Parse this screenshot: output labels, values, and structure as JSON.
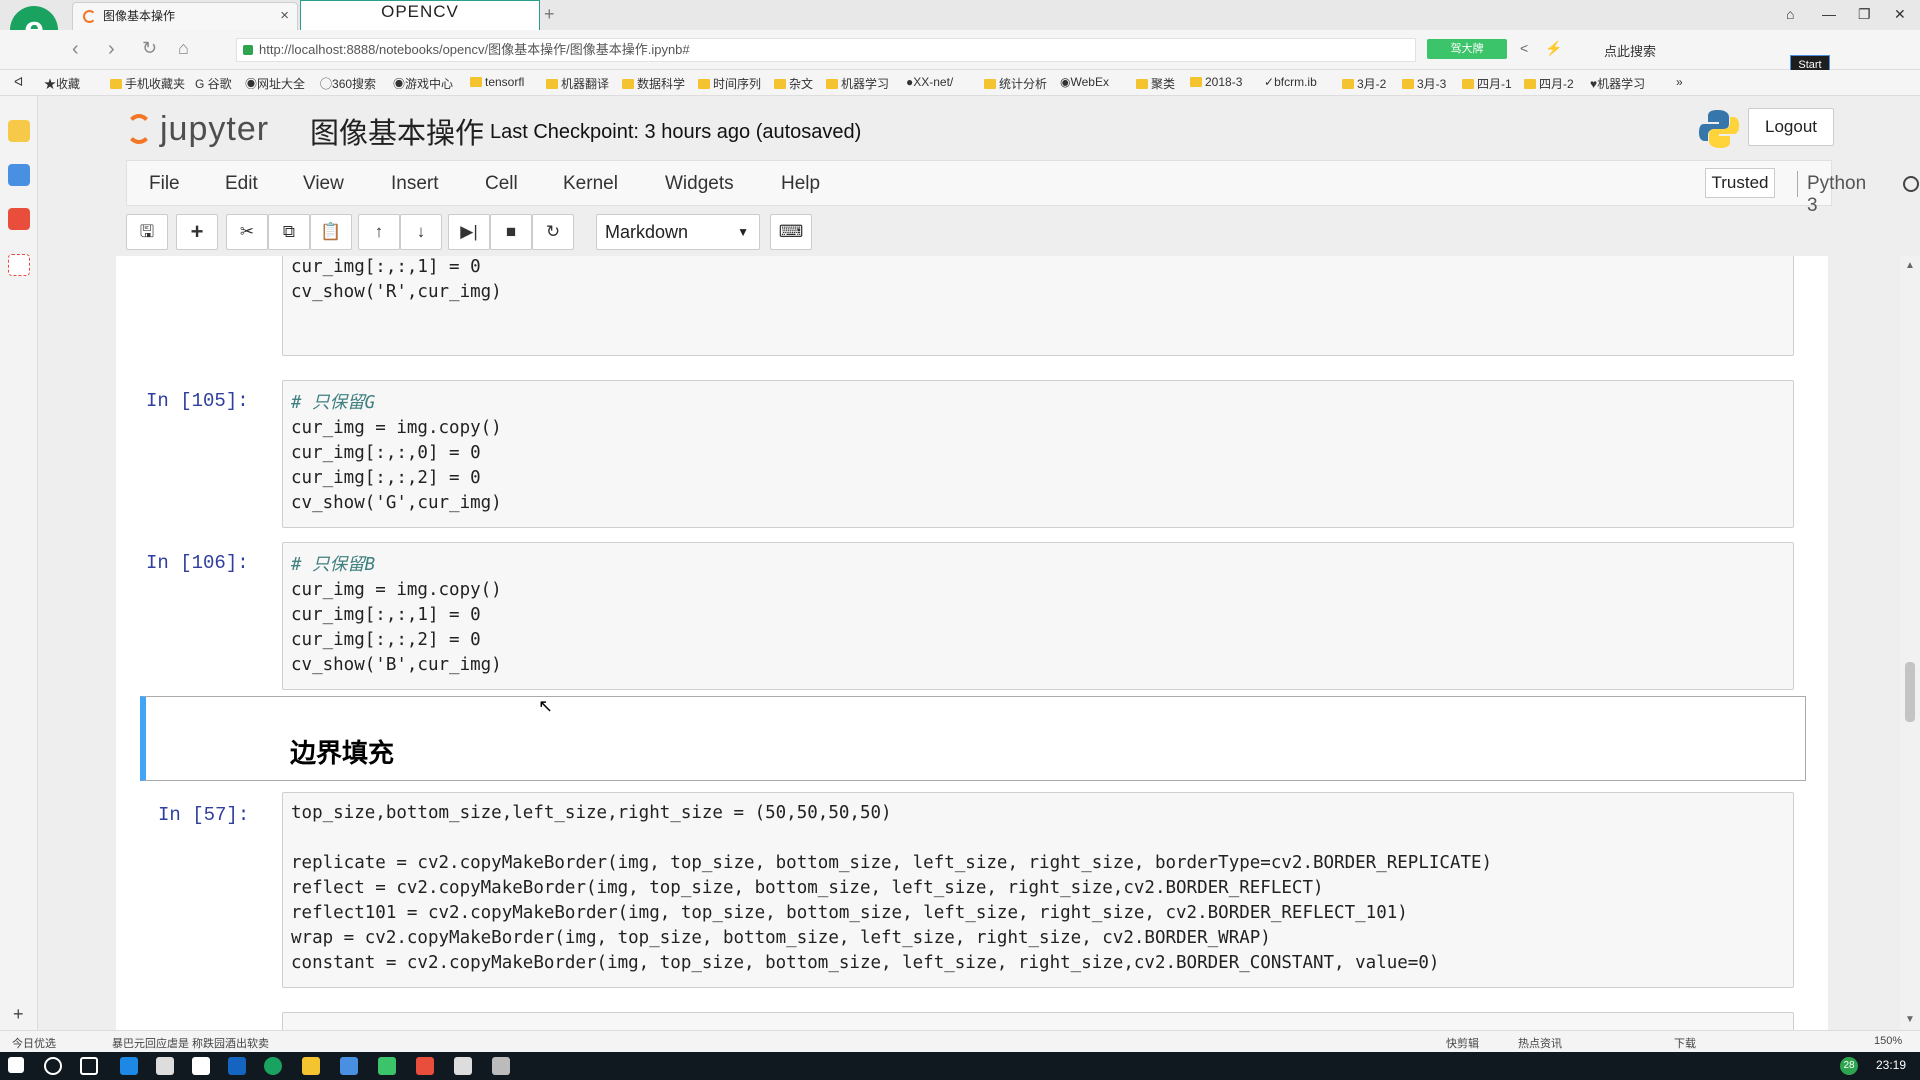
{
  "browser": {
    "logo": "e",
    "tab_title": "图像基本操作",
    "tab2_title": "OPENCV",
    "url": "http://localhost:8888/notebooks/opencv/图像基本操作/图像基本操作.ipynb#",
    "green_chip": "驾大牌",
    "search_hint": "点此搜索",
    "start_label": "Start",
    "bookmarks": [
      "收藏",
      "手机收藏夹",
      "谷歌",
      "网址大全",
      "360搜索",
      "游戏中心",
      "tensorfl",
      "机器翻译",
      "数据科学",
      "时间序列",
      "杂文",
      "机器学习",
      "XX-net/",
      "统计分析",
      "WebEx",
      "聚类",
      "2018-3",
      "bfcrm.ib",
      "3月-2",
      "3月-3",
      "四月-1",
      "四月-2",
      "机器学习"
    ]
  },
  "jupyter": {
    "logo_text": "jupyter",
    "notebook_title": "图像基本操作",
    "checkpoint": "Last Checkpoint: 3 hours ago (autosaved)",
    "logout": "Logout",
    "menu": [
      "File",
      "Edit",
      "View",
      "Insert",
      "Cell",
      "Kernel",
      "Widgets",
      "Help"
    ],
    "trusted": "Trusted",
    "kernel": "Python 3",
    "cell_type": "Markdown"
  },
  "cells": {
    "c0": {
      "lines": [
        "cur_img[:,:,1] = 0",
        "cv_show('R',cur_img)"
      ]
    },
    "c105": {
      "prompt": "In [105]:",
      "comment": "# 只保留G",
      "lines": [
        "cur_img = img.copy()",
        "cur_img[:,:,0] = 0",
        "cur_img[:,:,2] = 0",
        "cv_show('G',cur_img)"
      ]
    },
    "c106": {
      "prompt": "In [106]:",
      "comment": "# 只保留B",
      "lines": [
        "cur_img = img.copy()",
        "cur_img[:,:,1] = 0",
        "cur_img[:,:,2] = 0",
        "cv_show('B',cur_img)"
      ]
    },
    "md": {
      "heading": "边界填充"
    },
    "c57": {
      "prompt": "In [57]:",
      "lines": [
        "top_size,bottom_size,left_size,right_size = (50,50,50,50)",
        "",
        "replicate = cv2.copyMakeBorder(img, top_size, bottom_size, left_size, right_size, borderType=cv2.BORDER_REPLICATE)",
        "reflect = cv2.copyMakeBorder(img, top_size, bottom_size, left_size, right_size,cv2.BORDER_REFLECT)",
        "reflect101 = cv2.copyMakeBorder(img, top_size, bottom_size, left_size, right_size, cv2.BORDER_REFLECT_101)",
        "wrap = cv2.copyMakeBorder(img, top_size, bottom_size, left_size, right_size, cv2.BORDER_WRAP)",
        "constant = cv2.copyMakeBorder(img, top_size, bottom_size, left_size, right_size,cv2.BORDER_CONSTANT, value=0)"
      ]
    }
  },
  "statusbar": {
    "left": "今日优选",
    "news": "暴巴元回应虐是 称跌园酒出软卖",
    "items": [
      "快剪辑",
      "热点资讯",
      "下载",
      "150%"
    ]
  },
  "taskbar": {
    "clock": "23:19",
    "badge": "28"
  }
}
